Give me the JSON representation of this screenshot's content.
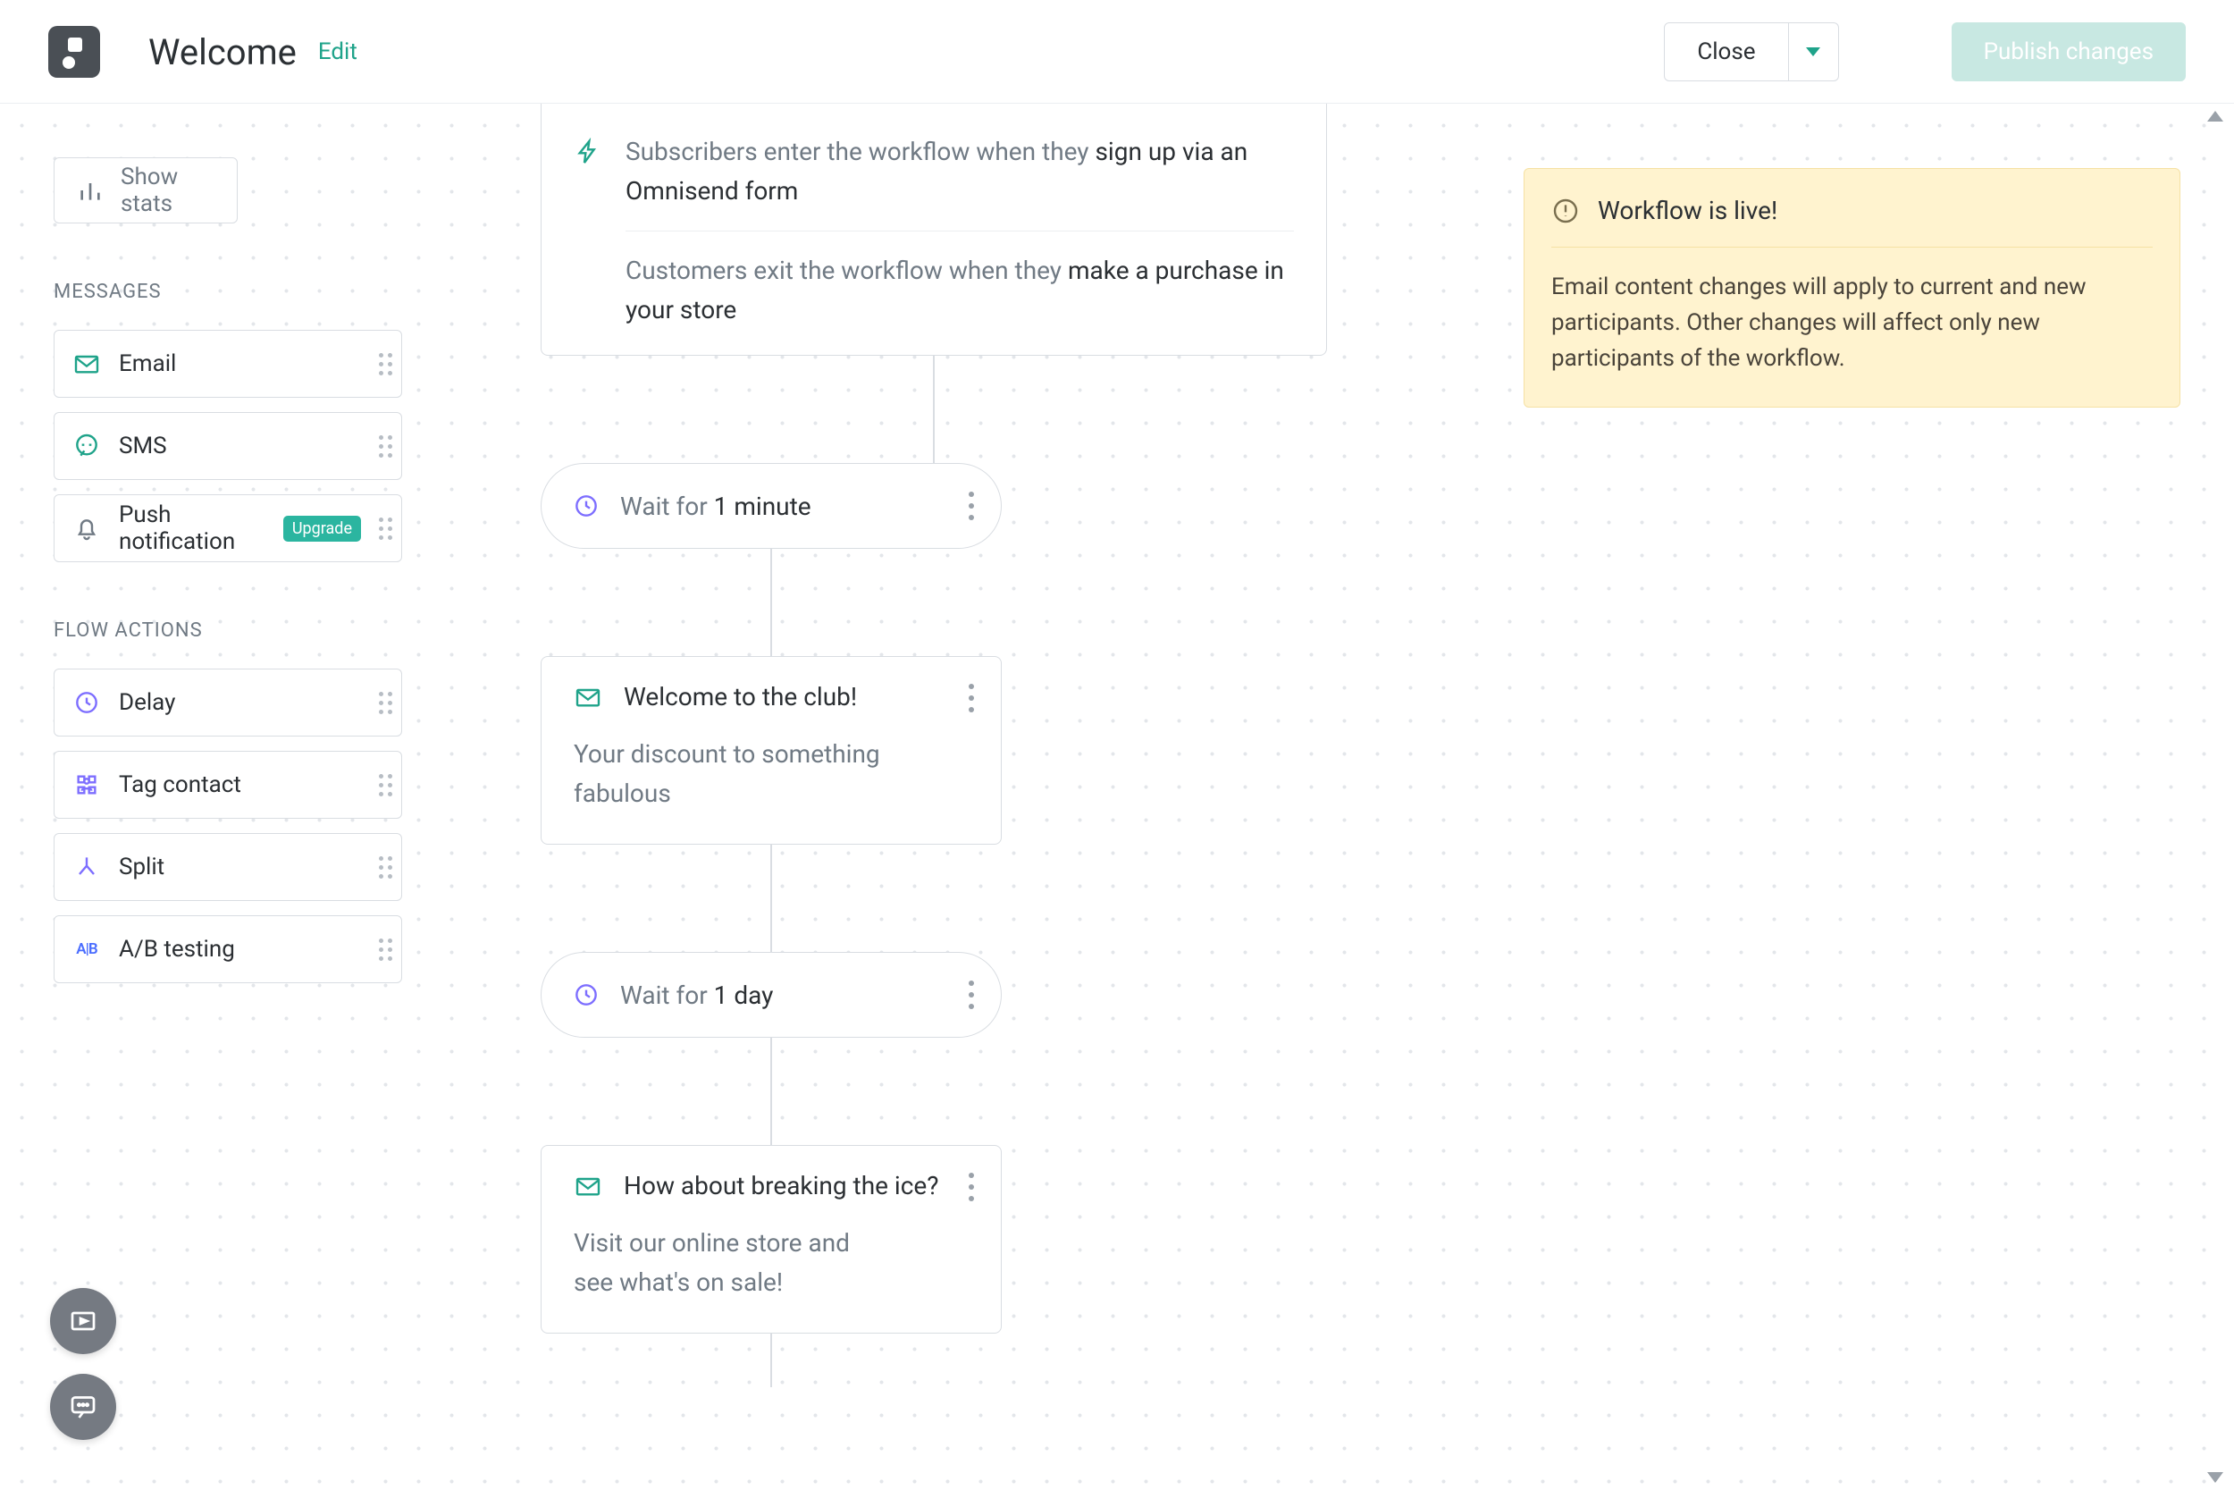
{
  "header": {
    "title": "Welcome",
    "edit": "Edit",
    "close": "Close",
    "publish": "Publish changes"
  },
  "sidebar": {
    "show_stats": "Show stats",
    "messages_label": "MESSAGES",
    "flow_label": "FLOW ACTIONS",
    "messages": {
      "email": "Email",
      "sms": "SMS",
      "push": "Push notification",
      "push_badge": "Upgrade"
    },
    "flow": {
      "delay": "Delay",
      "tag": "Tag contact",
      "split": "Split",
      "ab": "A/B testing"
    }
  },
  "trigger": {
    "enter_prefix": "Subscribers enter the workflow when they ",
    "enter_strong": "sign up via an Omnisend form",
    "exit_prefix": "Customers exit the workflow when they ",
    "exit_strong": "make a purchase in your store"
  },
  "wait1": {
    "prefix": "Wait for ",
    "strong": "1 minute"
  },
  "wait2": {
    "prefix": "Wait for ",
    "strong": "1 day"
  },
  "email1": {
    "title": "Welcome to the club!",
    "body": "Your discount to something fabulous"
  },
  "email2": {
    "title": "How about breaking the ice?",
    "body": "Visit our online store and see what's on sale!"
  },
  "info": {
    "title": "Workflow is live!",
    "body": "Email content changes will apply to current and new participants. Other changes will affect only new participants of the workflow."
  }
}
